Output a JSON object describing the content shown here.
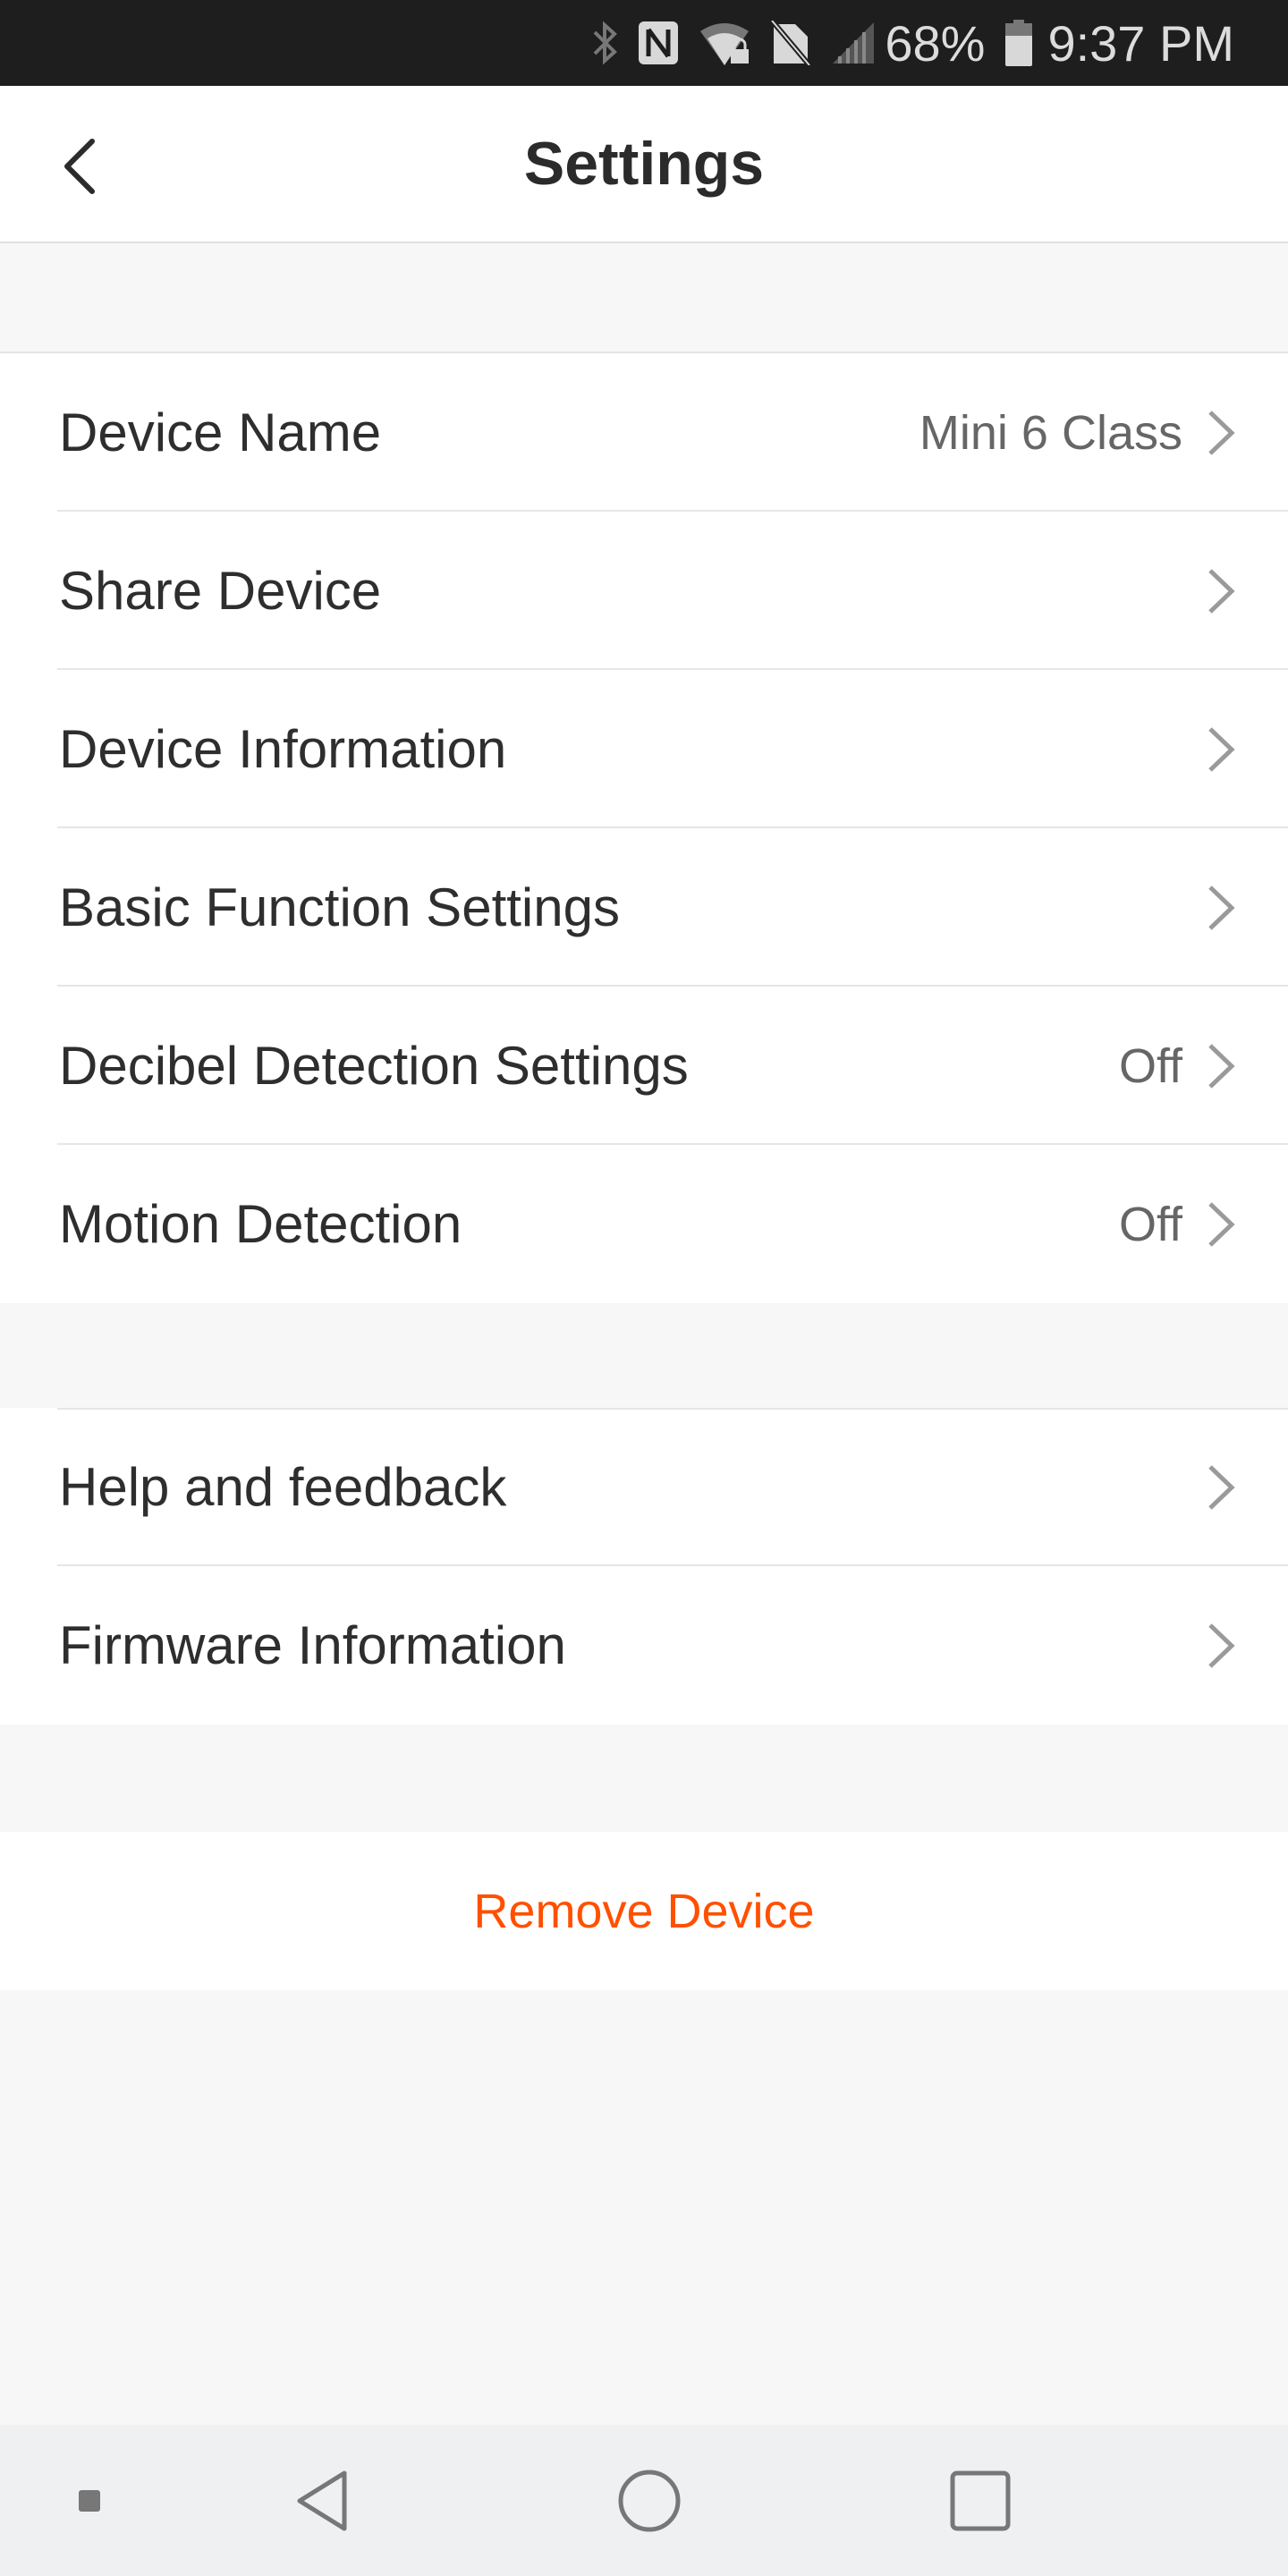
{
  "status_bar": {
    "icons": [
      "bluetooth-icon",
      "nfc-icon",
      "wifi-lock-icon",
      "no-sim-icon",
      "signal-icon",
      "battery-icon"
    ],
    "battery_percent": "68%",
    "time": "9:37 PM"
  },
  "header": {
    "back_icon": "chevron-left-icon",
    "title": "Settings"
  },
  "sections": [
    {
      "rows": [
        {
          "label": "Device Name",
          "value": "Mini 6 Class"
        },
        {
          "label": "Share Device",
          "value": ""
        },
        {
          "label": "Device Information",
          "value": ""
        },
        {
          "label": "Basic Function Settings",
          "value": ""
        },
        {
          "label": "Decibel Detection Settings",
          "value": "Off"
        },
        {
          "label": "Motion Detection",
          "value": "Off"
        }
      ]
    },
    {
      "rows": [
        {
          "label": "Help and feedback",
          "value": ""
        },
        {
          "label": "Firmware Information",
          "value": ""
        }
      ]
    }
  ],
  "remove": {
    "label": "Remove Device",
    "color": "#FF5000"
  },
  "nav_bar": {
    "buttons": [
      "menu-dot-icon",
      "back-triangle-icon",
      "home-circle-icon",
      "recents-square-icon"
    ]
  },
  "colors": {
    "status_bar_bg": "#1E1E1E",
    "page_bg": "#F7F7F7",
    "text_primary": "#2E2E2E",
    "text_secondary": "#666666",
    "accent": "#FF5000"
  }
}
